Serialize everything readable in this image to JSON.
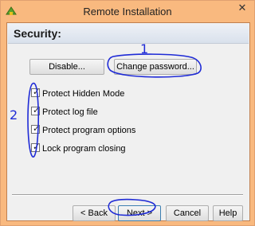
{
  "window": {
    "title": "Remote Installation",
    "close_glyph": "✕"
  },
  "header": {
    "title": "Security:"
  },
  "buttons": {
    "disable": "Disable...",
    "change_password": "Change password..."
  },
  "options": [
    {
      "label": "Protect Hidden Mode",
      "checked": true
    },
    {
      "label": "Protect log file",
      "checked": true
    },
    {
      "label": "Protect program options",
      "checked": true
    },
    {
      "label": "Lock program closing",
      "checked": true
    }
  ],
  "footer": {
    "back": "< Back",
    "next": "Next >",
    "cancel": "Cancel",
    "help": "Help"
  },
  "annotations": {
    "label_1": "1",
    "label_2": "2",
    "color": "#1f2bd6"
  },
  "colors": {
    "titlebar": "#f9b97f",
    "header_band": "#dde4ee"
  }
}
